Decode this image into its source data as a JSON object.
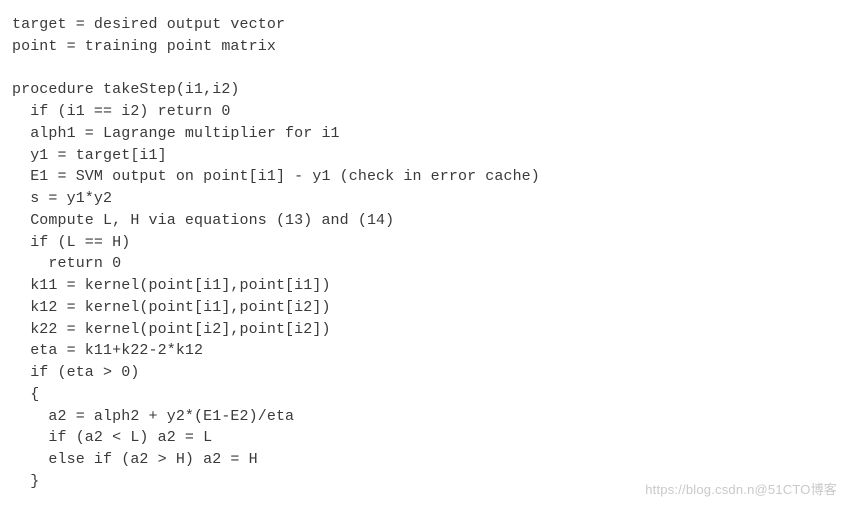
{
  "code": {
    "lines": [
      "target = desired output vector",
      "point = training point matrix",
      "",
      "procedure takeStep(i1,i2)",
      "  if (i1 == i2) return 0",
      "  alph1 = Lagrange multiplier for i1",
      "  y1 = target[i1]",
      "  E1 = SVM output on point[i1] - y1 (check in error cache)",
      "  s = y1*y2",
      "  Compute L, H via equations (13) and (14)",
      "  if (L == H)",
      "    return 0",
      "  k11 = kernel(point[i1],point[i1])",
      "  k12 = kernel(point[i1],point[i2])",
      "  k22 = kernel(point[i2],point[i2])",
      "  eta = k11+k22-2*k12",
      "  if (eta > 0)",
      "  {",
      "    a2 = alph2 + y2*(E1-E2)/eta",
      "    if (a2 < L) a2 = L",
      "    else if (a2 > H) a2 = H",
      "  }"
    ]
  },
  "watermark": "https://blog.csdn.n@51CTO博客"
}
